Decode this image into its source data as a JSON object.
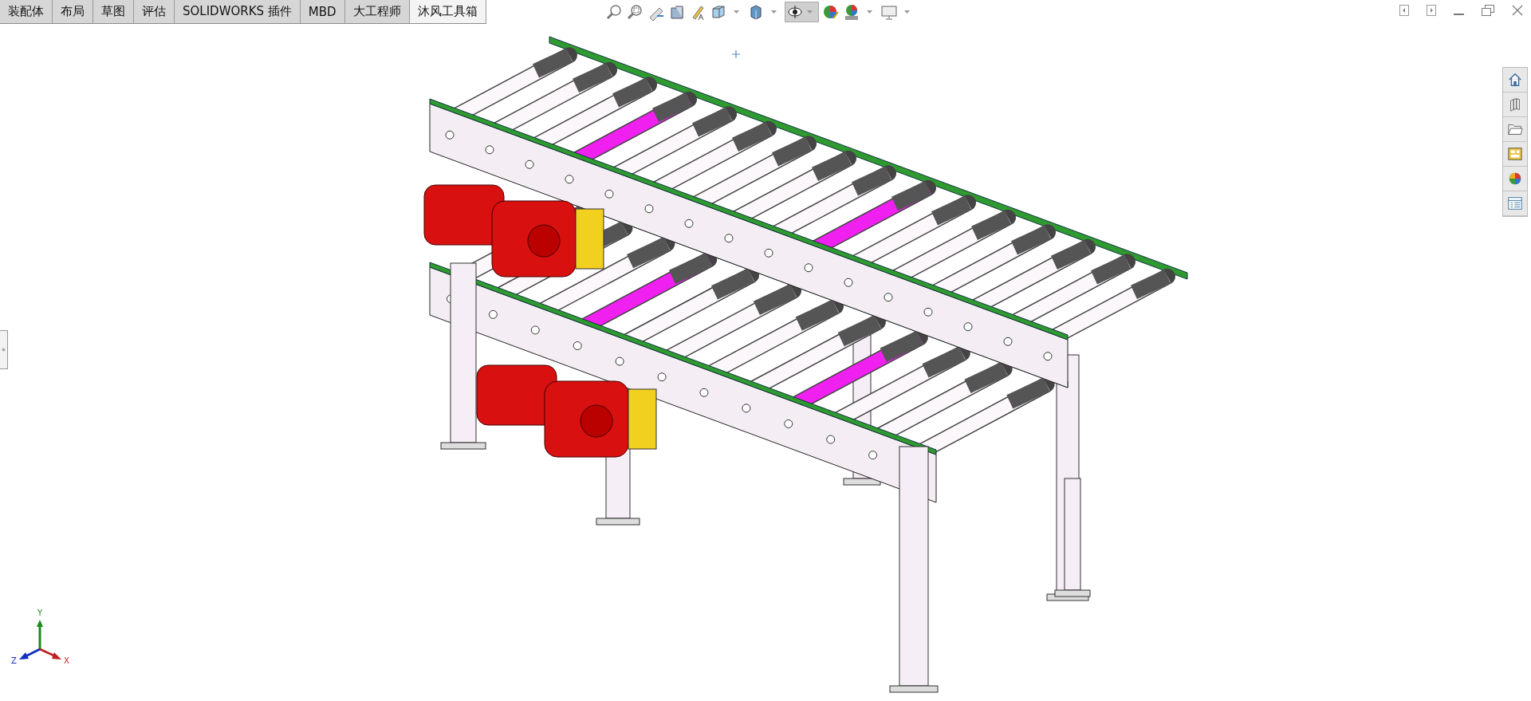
{
  "tabs": [
    {
      "label": "装配体",
      "selected": false
    },
    {
      "label": "布局",
      "selected": false
    },
    {
      "label": "草图",
      "selected": false
    },
    {
      "label": "评估",
      "selected": false
    },
    {
      "label": "SOLIDWORKS 插件",
      "selected": false
    },
    {
      "label": "MBD",
      "selected": false
    },
    {
      "label": "大工程师",
      "selected": false
    },
    {
      "label": "沐风工具箱",
      "selected": true
    }
  ],
  "triad": {
    "y": "Y",
    "z": "Z",
    "x": "X"
  }
}
